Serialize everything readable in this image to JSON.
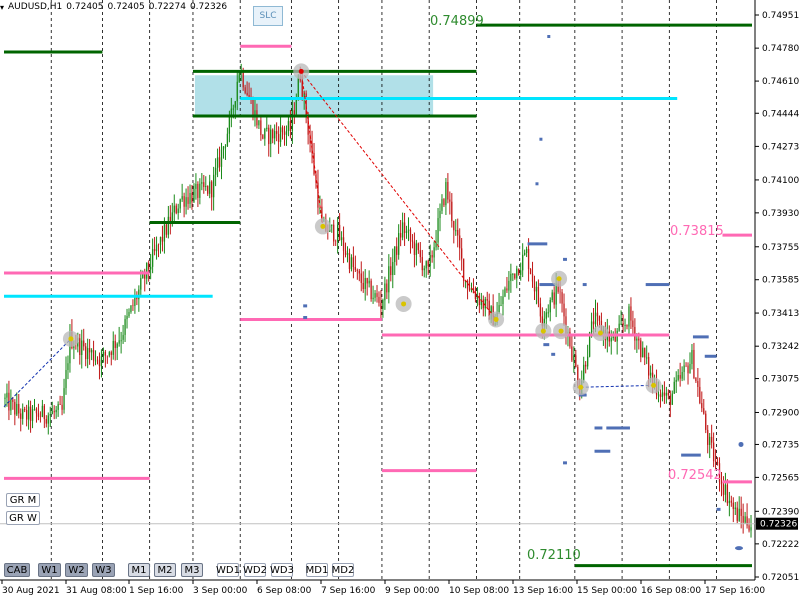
{
  "header": {
    "symbol": "AUDUSD,H1",
    "open": "0.72405",
    "high": "0.72405",
    "low": "0.72274",
    "close": "0.72326"
  },
  "slc_button": "SLC",
  "side_buttons": [
    "GR M",
    "GR W"
  ],
  "bottom_buttons": [
    {
      "label": "CAB",
      "style": "sel"
    },
    {
      "label": "W1",
      "style": "sel"
    },
    {
      "label": "W2",
      "style": "sel"
    },
    {
      "label": "W3",
      "style": "sel"
    },
    {
      "label": "M1",
      "style": "normal"
    },
    {
      "label": "M2",
      "style": "normal"
    },
    {
      "label": "M3",
      "style": "normal"
    },
    {
      "label": "WD1",
      "style": "flat"
    },
    {
      "label": "WD2",
      "style": "flat"
    },
    {
      "label": "WD3",
      "style": "flat"
    },
    {
      "label": "MD1",
      "style": "flat"
    },
    {
      "label": "MD2",
      "style": "flat"
    }
  ],
  "colors": {
    "bull": "#1a8a1a",
    "bear": "#c01818",
    "green_level": "#006400",
    "cyan_level": "#00e5ff",
    "pink_level": "#ff69b4",
    "blue_marker": "#4f6fb5",
    "zone": "#a8dde6",
    "dashed_red": "#e00000"
  },
  "chart_data": {
    "type": "candlestick",
    "symbol": "AUDUSD",
    "timeframe": "H1",
    "y_ticks": [
      "0.74951",
      "0.74780",
      "0.74610",
      "0.74444",
      "0.74273",
      "0.74100",
      "0.73930",
      "0.73755",
      "0.73585",
      "0.73413",
      "0.73242",
      "0.73075",
      "0.72900",
      "0.72735",
      "0.72565",
      "0.72390",
      "0.72222",
      "0.72051"
    ],
    "x_ticks": [
      "30 Aug 2021",
      "31 Aug 08:00",
      "1 Sep 16:00",
      "3 Sep 00:00",
      "6 Sep 08:00",
      "7 Sep 16:00",
      "9 Sep 00:00",
      "10 Sep 08:00",
      "13 Sep 16:00",
      "15 Sep 00:00",
      "16 Sep 08:00",
      "17 Sep 16:00"
    ],
    "ylim": [
      0.72051,
      0.74951
    ],
    "current_price": "0.72326",
    "level_labels": [
      {
        "text": "0.74899",
        "color": "green"
      },
      {
        "text": "0.73815",
        "color": "pink"
      },
      {
        "text": "0.72542",
        "color": "pink"
      },
      {
        "text": "0.72110",
        "color": "green"
      }
    ],
    "levels": [
      {
        "price": 0.74899,
        "color": "green",
        "from_bar": 240,
        "to_bar": 380
      },
      {
        "price": 0.7476,
        "color": "green",
        "from_bar": 0,
        "to_bar": 50
      },
      {
        "price": 0.7466,
        "color": "green",
        "from_bar": 96,
        "to_bar": 240
      },
      {
        "price": 0.7443,
        "color": "green",
        "from_bar": 96,
        "to_bar": 240
      },
      {
        "price": 0.7388,
        "color": "green",
        "from_bar": 74,
        "to_bar": 120
      },
      {
        "price": 0.7211,
        "color": "green",
        "from_bar": 290,
        "to_bar": 380
      },
      {
        "price": 0.7452,
        "color": "cyan",
        "from_bar": 120,
        "to_bar": 342
      },
      {
        "price": 0.735,
        "color": "cyan",
        "from_bar": 0,
        "to_bar": 106
      },
      {
        "price": 0.7362,
        "color": "pink",
        "from_bar": 0,
        "to_bar": 74
      },
      {
        "price": 0.7338,
        "color": "pink",
        "from_bar": 120,
        "to_bar": 192
      },
      {
        "price": 0.733,
        "color": "pink",
        "from_bar": 192,
        "to_bar": 338
      },
      {
        "price": 0.726,
        "color": "pink",
        "from_bar": 192,
        "to_bar": 240
      },
      {
        "price": 0.7256,
        "color": "pink",
        "from_bar": 0,
        "to_bar": 74
      },
      {
        "price": 0.72542,
        "color": "pink",
        "from_bar": 365,
        "to_bar": 380
      },
      {
        "price": 0.73815,
        "color": "pink",
        "from_bar": 365,
        "to_bar": 380
      },
      {
        "price": 0.7479,
        "color": "pink",
        "from_bar": 120,
        "to_bar": 146
      }
    ],
    "zone": {
      "from_bar": 97,
      "to_bar": 218,
      "high": 0.7464,
      "low": 0.7443
    },
    "vlines_bars": [
      24,
      50,
      74,
      96,
      120,
      146,
      170,
      192,
      216,
      240,
      262,
      290,
      314,
      338,
      362
    ],
    "anchors": [
      {
        "bar": 151,
        "price": 0.7466,
        "marker": "red"
      },
      {
        "bar": 162,
        "price": 0.7386
      },
      {
        "bar": 203,
        "price": 0.7346
      },
      {
        "bar": 250,
        "price": 0.7338
      },
      {
        "bar": 274,
        "price": 0.7332
      },
      {
        "bar": 282,
        "price": 0.7359
      },
      {
        "bar": 283,
        "price": 0.7332
      },
      {
        "bar": 293,
        "price": 0.7303
      },
      {
        "bar": 303,
        "price": 0.7331
      },
      {
        "bar": 330,
        "price": 0.7304
      },
      {
        "bar": 34,
        "price": 0.7328
      }
    ],
    "red_dashed_path": [
      [
        151,
        0.7466
      ],
      [
        162,
        0.7386
      ]
    ],
    "red_dashed_path2": [
      [
        151,
        0.7466
      ],
      [
        250,
        0.7338
      ]
    ],
    "blue_dashed_path": [
      [
        0,
        0.7293
      ],
      [
        34,
        0.7328
      ]
    ],
    "blue_dashed_path2": [
      [
        293,
        0.7303
      ],
      [
        330,
        0.7304
      ]
    ],
    "blue_markers": [
      {
        "bar": 266,
        "price": 0.7377,
        "w": 10
      },
      {
        "bar": 272,
        "price": 0.7431,
        "w": 1
      },
      {
        "bar": 270,
        "price": 0.7408,
        "w": 1
      },
      {
        "bar": 276,
        "price": 0.7484,
        "w": 1
      },
      {
        "bar": 272,
        "price": 0.7356,
        "w": 8
      },
      {
        "bar": 284,
        "price": 0.7369,
        "w": 2
      },
      {
        "bar": 294,
        "price": 0.7356,
        "w": 2
      },
      {
        "bar": 326,
        "price": 0.7356,
        "w": 12
      },
      {
        "bar": 274,
        "price": 0.7325,
        "w": 3
      },
      {
        "bar": 278,
        "price": 0.732,
        "w": 2
      },
      {
        "bar": 292,
        "price": 0.7299,
        "w": 4
      },
      {
        "bar": 300,
        "price": 0.7282,
        "w": 4
      },
      {
        "bar": 306,
        "price": 0.7282,
        "w": 12
      },
      {
        "bar": 350,
        "price": 0.7329,
        "w": 8
      },
      {
        "bar": 356,
        "price": 0.7319,
        "w": 6
      },
      {
        "bar": 300,
        "price": 0.727,
        "w": 8
      },
      {
        "bar": 344,
        "price": 0.7268,
        "w": 10
      },
      {
        "bar": 362,
        "price": 0.724,
        "w": 2
      },
      {
        "bar": 284,
        "price": 0.7264,
        "w": 2
      },
      {
        "bar": 152,
        "price": 0.7345,
        "w": 2
      },
      {
        "bar": 152,
        "price": 0.7339,
        "w": 2
      }
    ],
    "candles": {
      "generator": "seeded",
      "bars": 380,
      "waypoints": [
        [
          0,
          0.7297
        ],
        [
          10,
          0.7288
        ],
        [
          30,
          0.729
        ],
        [
          34,
          0.7328
        ],
        [
          50,
          0.7317
        ],
        [
          60,
          0.733
        ],
        [
          74,
          0.7365
        ],
        [
          90,
          0.74
        ],
        [
          106,
          0.7406
        ],
        [
          116,
          0.7442
        ],
        [
          120,
          0.7468
        ],
        [
          132,
          0.7432
        ],
        [
          146,
          0.7436
        ],
        [
          151,
          0.7465
        ],
        [
          162,
          0.7386
        ],
        [
          170,
          0.7382
        ],
        [
          180,
          0.736
        ],
        [
          192,
          0.7346
        ],
        [
          203,
          0.7386
        ],
        [
          216,
          0.7362
        ],
        [
          225,
          0.7406
        ],
        [
          235,
          0.7358
        ],
        [
          250,
          0.7338
        ],
        [
          258,
          0.736
        ],
        [
          266,
          0.7372
        ],
        [
          274,
          0.7339
        ],
        [
          282,
          0.7354
        ],
        [
          293,
          0.7303
        ],
        [
          300,
          0.7338
        ],
        [
          310,
          0.7326
        ],
        [
          318,
          0.734
        ],
        [
          330,
          0.7306
        ],
        [
          338,
          0.7296
        ],
        [
          350,
          0.7318
        ],
        [
          358,
          0.7276
        ],
        [
          366,
          0.7252
        ],
        [
          372,
          0.7238
        ],
        [
          380,
          0.72326
        ]
      ]
    }
  }
}
